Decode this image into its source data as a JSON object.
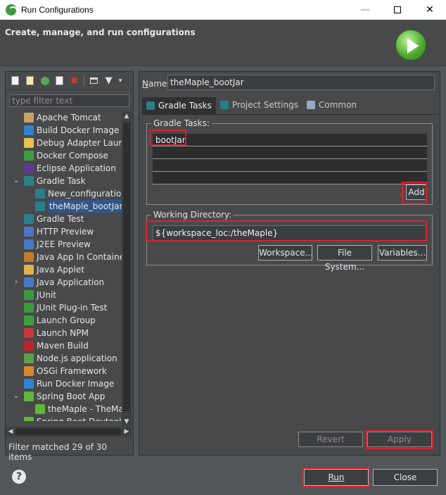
{
  "window": {
    "title": "Run Configurations",
    "min_glyph": "—",
    "close_glyph": "✕"
  },
  "header": {
    "title": "Create, manage, and run configurations"
  },
  "left_panel": {
    "filter_placeholder": "type filter text",
    "filter_status": "Filter matched 29 of 30 items",
    "tree_items": [
      {
        "label": "Apache Tomcat",
        "depth": 0,
        "icon": "tomcat-icon",
        "color": "#c9a36a"
      },
      {
        "label": "Build Docker Image",
        "depth": 0,
        "icon": "docker-build-icon",
        "color": "#2d84d3"
      },
      {
        "label": "Debug Adapter Launch",
        "depth": 0,
        "icon": "debug-adapter-icon",
        "color": "#e8c24a"
      },
      {
        "label": "Docker Compose",
        "depth": 0,
        "icon": "docker-compose-icon",
        "color": "#3da03d"
      },
      {
        "label": "Eclipse Application",
        "depth": 0,
        "icon": "eclipse-icon",
        "color": "#5a3d8a"
      },
      {
        "label": "Gradle Task",
        "depth": 0,
        "icon": "gradle-icon",
        "color": "#2a7f8a",
        "expanded": true
      },
      {
        "label": "New_configuration",
        "depth": 1,
        "icon": "gradle-icon",
        "color": "#2a7f8a"
      },
      {
        "label": "theMaple_bootJar",
        "depth": 1,
        "icon": "gradle-icon",
        "color": "#2a7f8a",
        "selected": true
      },
      {
        "label": "Gradle Test",
        "depth": 0,
        "icon": "gradle-icon",
        "color": "#2a7f8a"
      },
      {
        "label": "HTTP Preview",
        "depth": 0,
        "icon": "http-preview-icon",
        "color": "#4a78c4"
      },
      {
        "label": "J2EE Preview",
        "depth": 0,
        "icon": "j2ee-preview-icon",
        "color": "#4a78c4"
      },
      {
        "label": "Java App In Container",
        "depth": 0,
        "icon": "java-container-icon",
        "color": "#c47a2a"
      },
      {
        "label": "Java Applet",
        "depth": 0,
        "icon": "java-applet-icon",
        "color": "#e2b24a"
      },
      {
        "label": "Java Application",
        "depth": 0,
        "icon": "java-app-icon",
        "color": "#4a78c4",
        "collapsed": true
      },
      {
        "label": "JUnit",
        "depth": 0,
        "icon": "junit-icon",
        "color": "#3a9a3a"
      },
      {
        "label": "JUnit Plug-in Test",
        "depth": 0,
        "icon": "junit-plugin-icon",
        "color": "#3a9a3a"
      },
      {
        "label": "Launch Group",
        "depth": 0,
        "icon": "launch-group-icon",
        "color": "#3da03d"
      },
      {
        "label": "Launch NPM",
        "depth": 0,
        "icon": "npm-icon",
        "color": "#cb3837"
      },
      {
        "label": "Maven Build",
        "depth": 0,
        "icon": "maven-icon",
        "color": "#c8202a"
      },
      {
        "label": "Node.js application",
        "depth": 0,
        "icon": "nodejs-icon",
        "color": "#5fa04e"
      },
      {
        "label": "OSGi Framework",
        "depth": 0,
        "icon": "osgi-icon",
        "color": "#d58a2a"
      },
      {
        "label": "Run Docker Image",
        "depth": 0,
        "icon": "docker-run-icon",
        "color": "#2d84d3"
      },
      {
        "label": "Spring Boot App",
        "depth": 0,
        "icon": "spring-boot-icon",
        "color": "#5fb832",
        "expanded": true
      },
      {
        "label": "theMaple - TheMaple",
        "depth": 1,
        "icon": "spring-boot-icon",
        "color": "#5fb832"
      },
      {
        "label": "Spring Boot Devtools",
        "depth": 0,
        "icon": "spring-devtools-icon",
        "color": "#5fb832"
      }
    ]
  },
  "right_panel": {
    "name_label_u": "N",
    "name_label_rest": "ame:",
    "name_value": "theMaple_bootJar",
    "tabs": [
      {
        "label": "Gradle Tasks",
        "active": true,
        "icon": "gradle-tasks-icon",
        "color": "#2a7f8a"
      },
      {
        "label": "Project Settings",
        "active": false,
        "icon": "project-settings-icon",
        "color": "#2a7f8a"
      },
      {
        "label": "Common",
        "active": false,
        "icon": "common-icon",
        "color": "#9aa9c4"
      }
    ],
    "gradle_tasks": {
      "group_title": "Gradle Tasks:",
      "tasks": [
        "bootJar",
        "",
        "",
        ""
      ],
      "add_label": "Add"
    },
    "working_directory": {
      "group_title": "Working Directory:",
      "value": "${workspace_loc:/theMaple}",
      "workspace_label": "Workspace...",
      "filesystem_label": "File System...",
      "variables_label": "Variables..."
    },
    "revert_label": "Revert",
    "apply_label": "Apply"
  },
  "footer": {
    "help_glyph": "?",
    "run_label": "Run",
    "close_label": "Close"
  }
}
